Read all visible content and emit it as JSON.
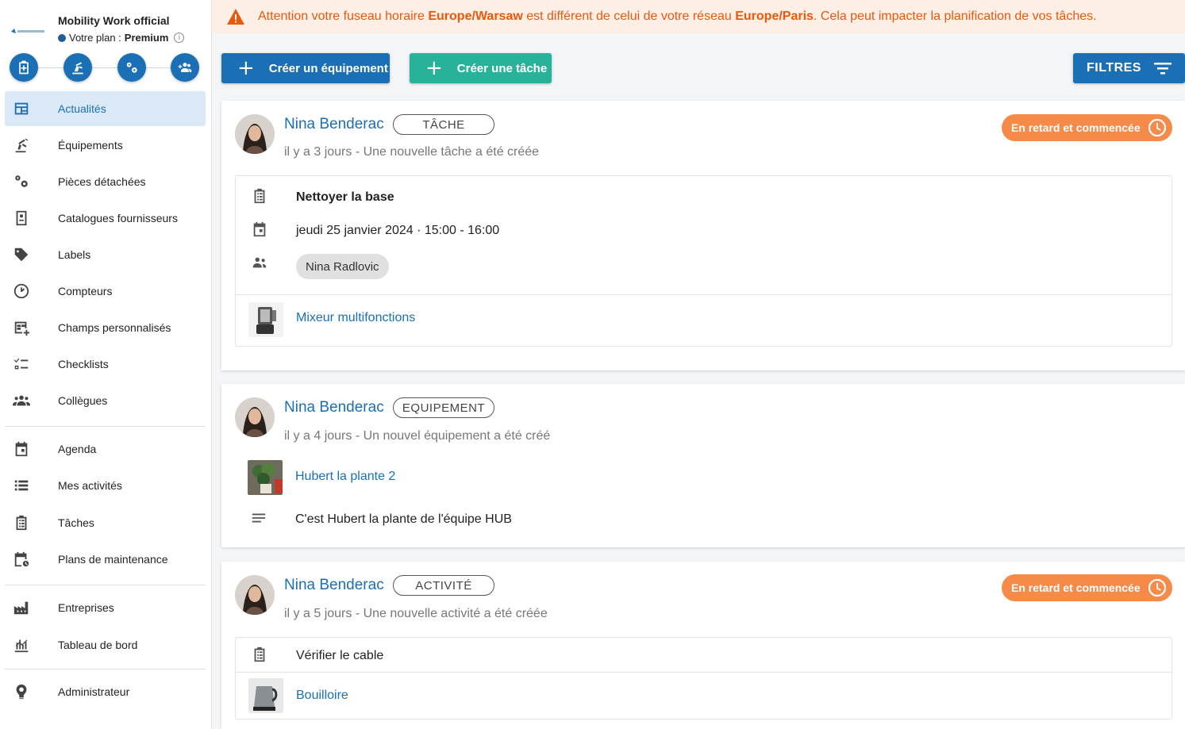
{
  "sidebar": {
    "org_title": "Mobility Work official",
    "plan_prefix": "Votre plan : ",
    "plan_name": "Premium",
    "info_glyph": "i",
    "quick_actions": [
      {
        "icon": "add-task-icon"
      },
      {
        "icon": "add-equipment-icon"
      },
      {
        "icon": "add-parts-icon"
      },
      {
        "icon": "add-user-icon"
      }
    ],
    "items": [
      {
        "label": "Actualités",
        "icon": "newsfeed-icon",
        "active": true
      },
      {
        "label": "Équipements",
        "icon": "equipment-icon"
      },
      {
        "label": "Pièces détachées",
        "icon": "parts-icon"
      },
      {
        "label": "Catalogues fournisseurs",
        "icon": "catalog-icon"
      },
      {
        "label": "Labels",
        "icon": "label-icon"
      },
      {
        "label": "Compteurs",
        "icon": "meter-icon"
      },
      {
        "label": "Champs personnalisés",
        "icon": "custom-fields-icon"
      },
      {
        "label": "Checklists",
        "icon": "checklist-icon"
      },
      {
        "label": "Collègues",
        "icon": "colleagues-icon"
      },
      {
        "label": "Agenda",
        "icon": "calendar-icon"
      },
      {
        "label": "Mes activités",
        "icon": "list-icon"
      },
      {
        "label": "Tâches",
        "icon": "clipboard-icon"
      },
      {
        "label": "Plans de maintenance",
        "icon": "maintenance-plan-icon"
      },
      {
        "label": "Entreprises",
        "icon": "factory-icon"
      },
      {
        "label": "Tableau de bord",
        "icon": "dashboard-icon"
      },
      {
        "label": "Administrateur",
        "icon": "admin-icon"
      }
    ]
  },
  "banner": {
    "part1": "Attention votre fuseau horaire ",
    "tz_user": "Europe/Warsaw",
    "part2": " est différent de celui de votre réseau ",
    "tz_network": "Europe/Paris",
    "part3": ". Cela peut impacter la planification de vos tâches."
  },
  "toolbar": {
    "create_equipment": "Créer un équipement",
    "create_task": "Créer une tâche",
    "filters": "FILTRES",
    "plus_glyph": "+"
  },
  "feed": [
    {
      "author": "Nina Benderac",
      "tag": "TÂCHE",
      "meta": "il y a 3 jours - Une nouvelle tâche a été créée",
      "status": "En retard et commencée",
      "title": "Nettoyer la base",
      "date": "jeudi 25 janvier 2024 · 15:00 - 16:00",
      "assignee": "Nina Radlovic",
      "equipment": "Mixeur multifonctions"
    },
    {
      "author": "Nina Benderac",
      "tag": "EQUIPEMENT",
      "meta": "il y a 4 jours - Un nouvel équipement a été créé",
      "equipment": "Hubert la plante 2",
      "description": "C'est Hubert la plante de l'équipe HUB"
    },
    {
      "author": "Nina Benderac",
      "tag": "ACTIVITÉ",
      "meta": "il y a 5 jours - Une nouvelle activité a été créée",
      "status": "En retard et commencée",
      "title": "Vérifier le cable",
      "equipment": "Bouilloire"
    }
  ],
  "colors": {
    "primary": "#1a6fb5",
    "green": "#27b39a",
    "orange": "#f68a48",
    "warning": "#e8590c"
  }
}
